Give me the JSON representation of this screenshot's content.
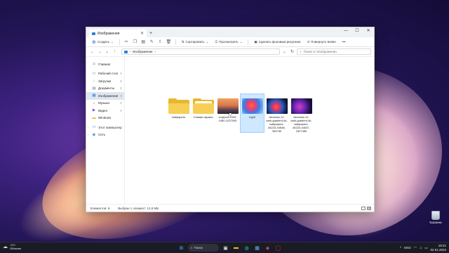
{
  "window": {
    "tab_title": "Изображения",
    "controls": {
      "minimize": "—",
      "maximize": "☐",
      "close": "✕"
    }
  },
  "toolbar": {
    "create": "Создать",
    "sort": "Сортировать",
    "view": "Просмотреть",
    "set_background": "Сделать фоновым рисунком",
    "rotate_left": "Повернуть влево",
    "more": "•••"
  },
  "address": {
    "path": "Изображения",
    "search_placeholder": "Поиск в: Изображения"
  },
  "sidebar": {
    "items": [
      {
        "label": "Главная",
        "icon": "home-icon",
        "glyph": "⌂"
      },
      {
        "label": "Рабочий стол",
        "icon": "desktop-icon",
        "glyph": "▭",
        "pinned": true
      },
      {
        "label": "Загрузки",
        "icon": "download-icon",
        "glyph": "↓",
        "pinned": true
      },
      {
        "label": "Документы",
        "icon": "documents-icon",
        "glyph": "▤",
        "pinned": true
      },
      {
        "label": "Изображения",
        "icon": "pictures-icon",
        "glyph": "▦",
        "pinned": true,
        "selected": true
      },
      {
        "label": "Музыка",
        "icon": "music-icon",
        "glyph": "♪",
        "pinned": true
      },
      {
        "label": "Видео",
        "icon": "video-icon",
        "glyph": "▶",
        "pinned": true
      },
      {
        "label": "Windows",
        "icon": "folder-icon",
        "glyph": "▬"
      },
      {
        "label": "Этот компьютер",
        "icon": "computer-icon",
        "glyph": "▭"
      },
      {
        "label": "Сеть",
        "icon": "network-icon",
        "glyph": "◉"
      }
    ]
  },
  "files": [
    {
      "name": "wallpapers",
      "kind": "folder"
    },
    {
      "name": "Снимки экрана",
      "kind": "folder"
    },
    {
      "name": "cropped-1920-1080-1237940",
      "kind": "image",
      "style": "t-coast"
    },
    {
      "name": "Light",
      "kind": "image",
      "style": "t-light",
      "selected": true
    },
    {
      "name": "windows-11-dark-gradient-4k-wallpapers-45223-44548-305750",
      "kind": "image",
      "style": "t-dark1"
    },
    {
      "name": "windows-11-dark-gradient-4k-wallpapers-45223-44037-2327469",
      "kind": "image",
      "style": "t-dark2"
    }
  ],
  "status": {
    "count": "Элементов: 6",
    "selection": "Выбран 1 элемент: 12,9 МБ"
  },
  "desktop": {
    "recycle_bin": "Корзина"
  },
  "taskbar": {
    "temperature": "-3°C",
    "weather": "Облачно",
    "search": "Поиск",
    "language": "ENG",
    "time": "18:21",
    "date": "02.01.2023"
  }
}
